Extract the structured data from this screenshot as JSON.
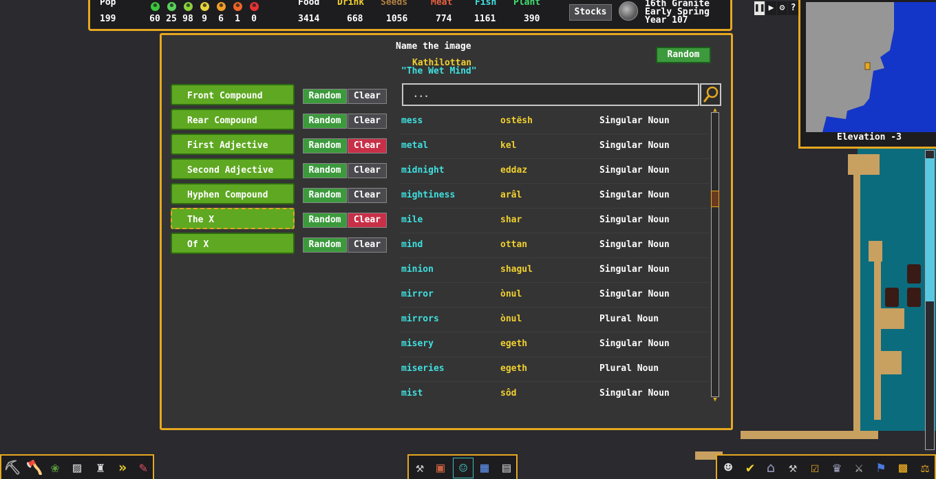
{
  "topbar": {
    "pop_label": "Pop",
    "pop_value": "199",
    "happiness": [
      {
        "icon": "ecstatic-face-icon",
        "color": "#3cc83c",
        "value": "60"
      },
      {
        "icon": "happy-face-icon",
        "color": "#5ad25a",
        "value": "25"
      },
      {
        "icon": "content-face-icon",
        "color": "#8ad23c",
        "value": "98"
      },
      {
        "icon": "neutral-face-icon",
        "color": "#e6d23c",
        "value": "9"
      },
      {
        "icon": "unhappy-face-icon",
        "color": "#f0a028",
        "value": "6"
      },
      {
        "icon": "angry-face-icon",
        "color": "#f06428",
        "value": "1"
      },
      {
        "icon": "miserable-face-icon",
        "color": "#e63232",
        "value": "0"
      }
    ],
    "stocks": [
      {
        "label": "Food",
        "value": "3414",
        "color": "#ffffff"
      },
      {
        "label": "Drink",
        "value": "668",
        "color": "#f0d030"
      },
      {
        "label": "Seeds",
        "value": "1056",
        "color": "#b08040"
      },
      {
        "label": "Meat",
        "value": "774",
        "color": "#e86040"
      },
      {
        "label": "Fish",
        "value": "1161",
        "color": "#40e0e0"
      },
      {
        "label": "Plant",
        "value": "390",
        "color": "#40e070"
      }
    ],
    "stocks_button": "Stocks",
    "date_line1": "16th Granite",
    "date_line2": "Early Spring",
    "date_line3": "Year 107"
  },
  "minimap": {
    "elevation": "Elevation -3"
  },
  "dialog": {
    "title": "Name the image",
    "random_button": "Random",
    "name_native": "Kathilottan",
    "name_english": "\"The Wet Mind\"",
    "components": [
      {
        "label": "Front Compound",
        "random": "Random",
        "clear": "Clear",
        "clear_red": false,
        "selected": false
      },
      {
        "label": "Rear Compound",
        "random": "Random",
        "clear": "Clear",
        "clear_red": false,
        "selected": false
      },
      {
        "label": "First Adjective",
        "random": "Random",
        "clear": "Clear",
        "clear_red": true,
        "selected": false
      },
      {
        "label": "Second Adjective",
        "random": "Random",
        "clear": "Clear",
        "clear_red": false,
        "selected": false
      },
      {
        "label": "Hyphen Compound",
        "random": "Random",
        "clear": "Clear",
        "clear_red": false,
        "selected": false
      },
      {
        "label": "The X",
        "random": "Random",
        "clear": "Clear",
        "clear_red": true,
        "selected": true
      },
      {
        "label": "Of X",
        "random": "Random",
        "clear": "Clear",
        "clear_red": false,
        "selected": false
      }
    ],
    "search_placeholder": "...",
    "words": [
      {
        "english": "mess",
        "dwarven": "ostësh",
        "type": "Singular Noun"
      },
      {
        "english": "metal",
        "dwarven": "kel",
        "type": "Singular Noun"
      },
      {
        "english": "midnight",
        "dwarven": "eddaz",
        "type": "Singular Noun"
      },
      {
        "english": "mightiness",
        "dwarven": "arâl",
        "type": "Singular Noun"
      },
      {
        "english": "mile",
        "dwarven": "shar",
        "type": "Singular Noun"
      },
      {
        "english": "mind",
        "dwarven": "ottan",
        "type": "Singular Noun"
      },
      {
        "english": "minion",
        "dwarven": "shagul",
        "type": "Singular Noun"
      },
      {
        "english": "mirror",
        "dwarven": "ònul",
        "type": "Singular Noun"
      },
      {
        "english": "mirrors",
        "dwarven": "ònul",
        "type": "Plural Noun"
      },
      {
        "english": "misery",
        "dwarven": "egeth",
        "type": "Singular Noun"
      },
      {
        "english": "miseries",
        "dwarven": "egeth",
        "type": "Plural Noun"
      },
      {
        "english": "mist",
        "dwarven": "sôd",
        "type": "Singular Noun"
      }
    ]
  },
  "toolbar_left": [
    "pickaxe-dig-icon",
    "axe-chop-tree-icon",
    "plant-gather-icon",
    "smooth-stone-icon",
    "erase-designation-icon",
    "fast-forward-icon",
    "eraser-icon"
  ],
  "toolbar_center": [
    "build-icon",
    "furniture-icon",
    "units-icon",
    "zones-icon",
    "minecart-icon"
  ],
  "toolbar_right": [
    "citizens-icon",
    "tasks-icon",
    "places-icon",
    "labor-icon",
    "orders-icon",
    "nobles-icon",
    "justice-icon",
    "hauling-icon",
    "map-icon",
    "scales-icon"
  ]
}
